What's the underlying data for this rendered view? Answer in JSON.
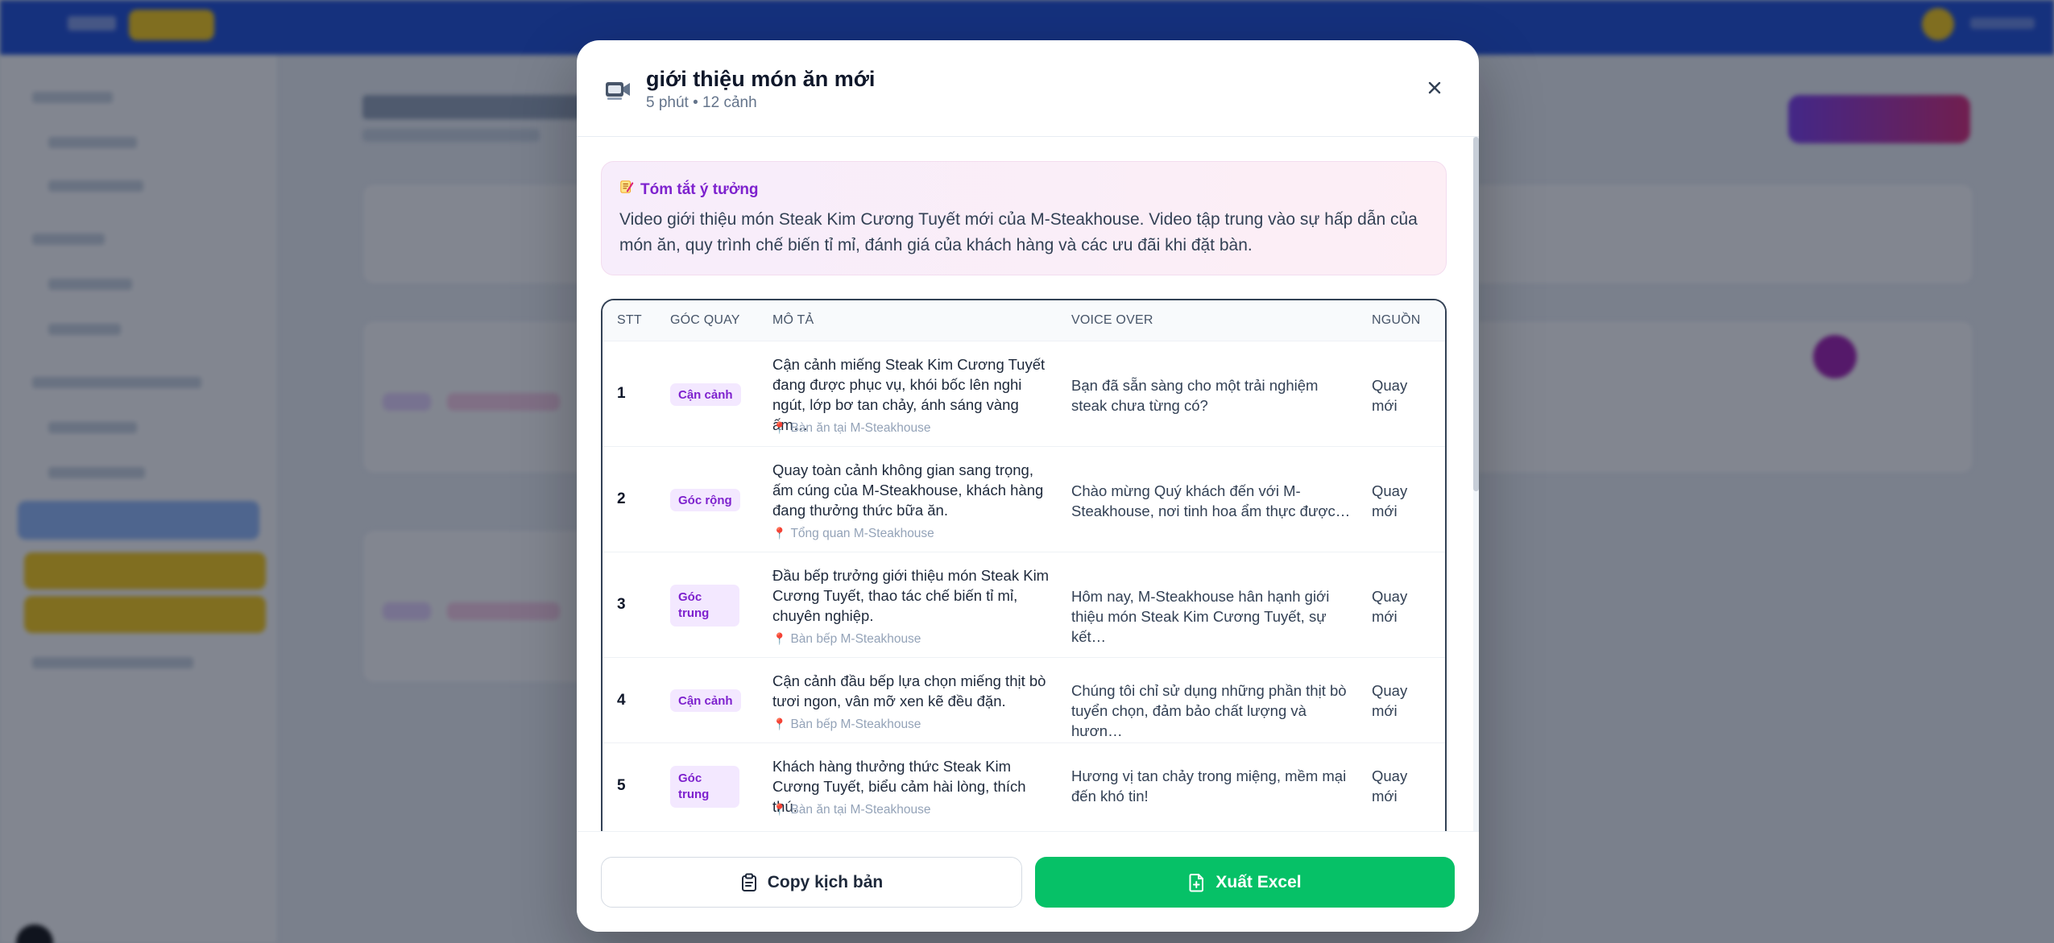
{
  "modal": {
    "title": "giới thiệu món ăn mới",
    "subtitle": "5 phút • 12 cảnh",
    "close_icon": "close-icon",
    "title_icon": "video-camera-icon"
  },
  "summary": {
    "heading": "Tóm tắt ý tưởng",
    "icon": "memo-icon",
    "text": "Video giới thiệu món Steak Kim Cương Tuyết mới của M-Steakhouse. Video tập trung vào sự hấp dẫn của món ăn, quy trình chế biến tỉ mỉ, đánh giá của khách hàng và các ưu đãi khi đặt bàn."
  },
  "table": {
    "headers": {
      "stt": "STT",
      "angle": "GÓC QUAY",
      "desc": "MÔ TẢ",
      "voice": "VOICE OVER",
      "source": "NGUỒN"
    },
    "rows": [
      {
        "stt": "1",
        "angle": "Cận cảnh",
        "desc": "Cận cảnh miếng Steak Kim Cương Tuyết đang được phục vụ, khói bốc lên nghi ngút, lớp bơ tan chảy, ánh sáng vàng ấm…",
        "location": "Bàn ăn tại M-Steakhouse",
        "voice": "Bạn đã sẵn sàng cho một trải nghiệm steak chưa từng có?",
        "source": "Quay mới"
      },
      {
        "stt": "2",
        "angle": "Góc rộng",
        "desc": "Quay toàn cảnh không gian sang trọng, ấm cúng của M-Steakhouse, khách hàng đang thưởng thức bữa ăn.",
        "location": "Tổng quan M-Steakhouse",
        "voice": "Chào mừng Quý khách đến với M-Steakhouse, nơi tinh hoa ẩm thực được…",
        "source": "Quay mới"
      },
      {
        "stt": "3",
        "angle": "Góc trung",
        "desc": "Đầu bếp trưởng giới thiệu món Steak Kim Cương Tuyết, thao tác chế biến tỉ mỉ, chuyên nghiệp.",
        "location": "Bàn bếp M-Steakhouse",
        "voice": "Hôm nay, M-Steakhouse hân hạnh giới thiệu món Steak Kim Cương Tuyết, sự kết…",
        "source": "Quay mới"
      },
      {
        "stt": "4",
        "angle": "Cận cảnh",
        "desc": "Cận cảnh đầu bếp lựa chọn miếng thịt bò tươi ngon, vân mỡ xen kẽ đều đặn.",
        "location": "Bàn bếp M-Steakhouse",
        "voice": "Chúng tôi chỉ sử dụng những phần thịt bò tuyển chọn, đảm bảo chất lượng và hươn…",
        "source": "Quay mới"
      },
      {
        "stt": "5",
        "angle": "Góc trung",
        "desc": "Khách hàng thưởng thức Steak Kim Cương Tuyết, biểu cảm hài lòng, thích thú.",
        "location": "Bàn ăn tại M-Steakhouse",
        "voice": "Hương vị tan chảy trong miệng, mềm mại đến khó tin!",
        "source": "Quay mới"
      }
    ]
  },
  "footer": {
    "copy_label": "Copy kịch bản",
    "copy_icon": "clipboard-icon",
    "excel_label": "Xuất Excel",
    "excel_icon": "file-export-icon"
  },
  "colors": {
    "accent_purple": "#7e22ce",
    "tag_bg": "#f3e8ff",
    "excel_green": "#06c167",
    "topbar_blue": "#1d4ed8"
  }
}
